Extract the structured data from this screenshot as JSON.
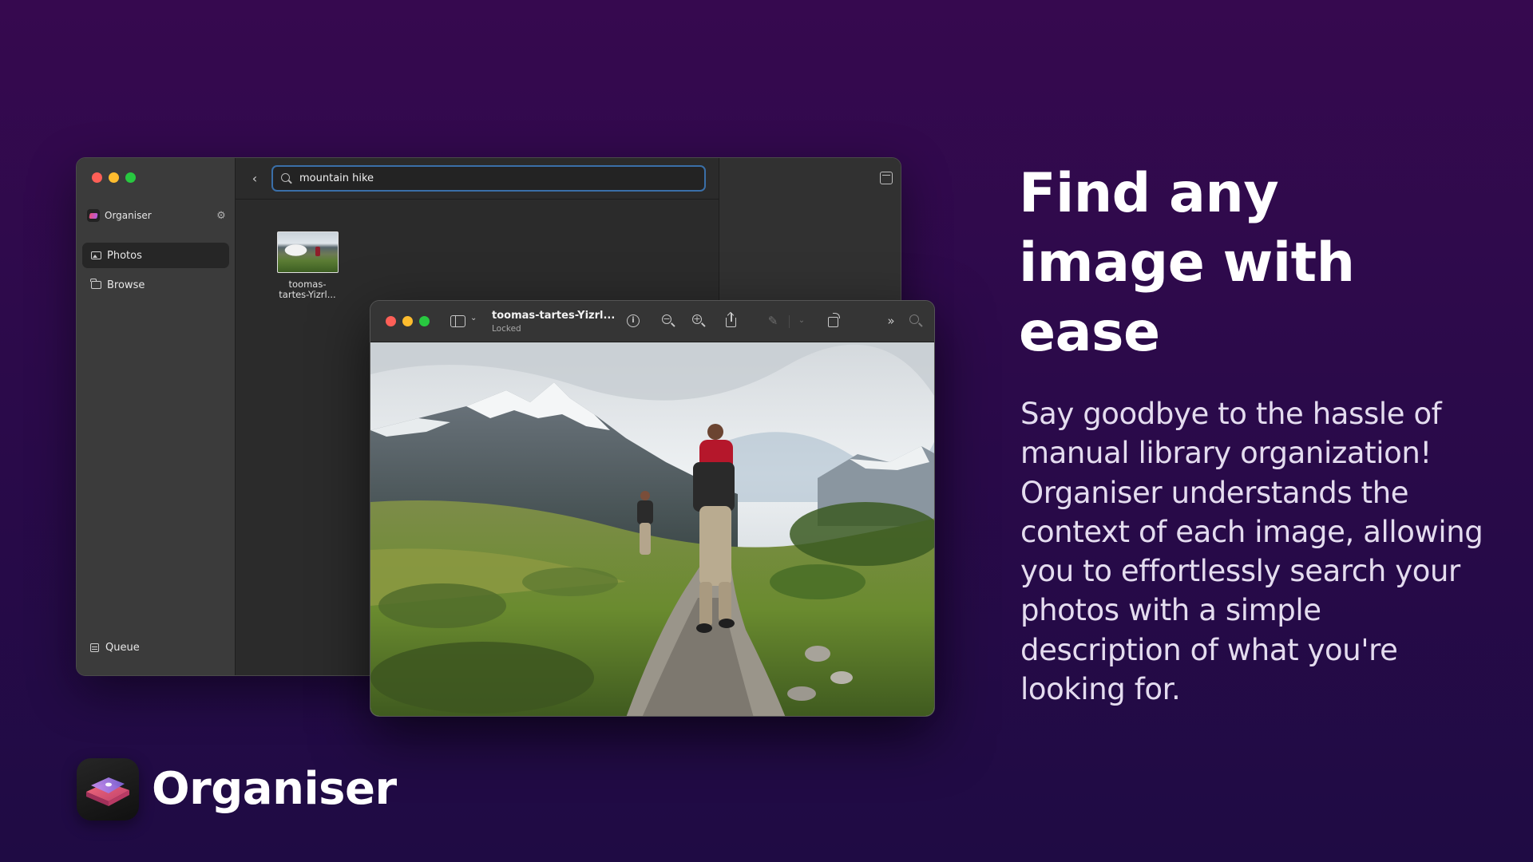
{
  "main_window": {
    "sidebar": {
      "app_name": "Organiser",
      "items": [
        {
          "label": "Photos",
          "icon": "photo-icon",
          "active": true
        },
        {
          "label": "Browse",
          "icon": "folder-icon",
          "active": false
        }
      ],
      "queue_label": "Queue"
    },
    "search": {
      "value": "mountain hike",
      "placeholder": ""
    },
    "results": [
      {
        "label": "toomas-\ntartes-Yizrl..."
      }
    ]
  },
  "preview_window": {
    "title": "toomas-tartes-Yizrl...",
    "subtitle": "Locked"
  },
  "marketing": {
    "headline": "Find any image with ease",
    "body": "Say goodbye to the hassle of manual library organization! Organiser understands the context of each image, allowing you to effortlessly search your photos with a simple description of what you're looking for."
  },
  "brand": {
    "name": "Organiser"
  },
  "colors": {
    "background_top": "#36094f",
    "background_bottom": "#1f0b44",
    "search_focus": "#3a6fa8",
    "traffic_red": "#fe5f57",
    "traffic_yellow": "#febc2e",
    "traffic_green": "#28c840"
  }
}
